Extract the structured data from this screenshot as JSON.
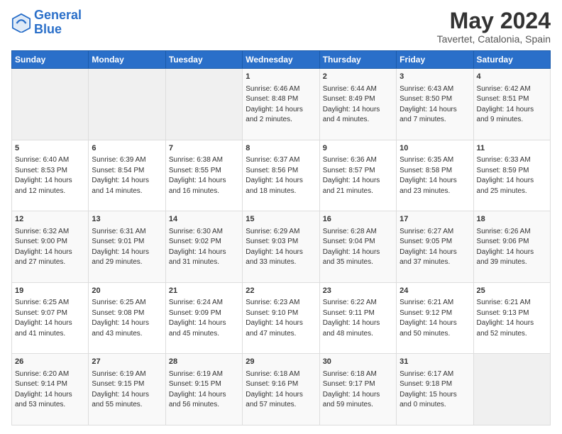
{
  "header": {
    "logo_line1": "General",
    "logo_line2": "Blue",
    "main_title": "May 2024",
    "subtitle": "Tavertet, Catalonia, Spain"
  },
  "calendar": {
    "columns": [
      "Sunday",
      "Monday",
      "Tuesday",
      "Wednesday",
      "Thursday",
      "Friday",
      "Saturday"
    ],
    "weeks": [
      [
        {
          "day": "",
          "info": ""
        },
        {
          "day": "",
          "info": ""
        },
        {
          "day": "",
          "info": ""
        },
        {
          "day": "1",
          "info": "Sunrise: 6:46 AM\nSunset: 8:48 PM\nDaylight: 14 hours\nand 2 minutes."
        },
        {
          "day": "2",
          "info": "Sunrise: 6:44 AM\nSunset: 8:49 PM\nDaylight: 14 hours\nand 4 minutes."
        },
        {
          "day": "3",
          "info": "Sunrise: 6:43 AM\nSunset: 8:50 PM\nDaylight: 14 hours\nand 7 minutes."
        },
        {
          "day": "4",
          "info": "Sunrise: 6:42 AM\nSunset: 8:51 PM\nDaylight: 14 hours\nand 9 minutes."
        }
      ],
      [
        {
          "day": "5",
          "info": "Sunrise: 6:40 AM\nSunset: 8:53 PM\nDaylight: 14 hours\nand 12 minutes."
        },
        {
          "day": "6",
          "info": "Sunrise: 6:39 AM\nSunset: 8:54 PM\nDaylight: 14 hours\nand 14 minutes."
        },
        {
          "day": "7",
          "info": "Sunrise: 6:38 AM\nSunset: 8:55 PM\nDaylight: 14 hours\nand 16 minutes."
        },
        {
          "day": "8",
          "info": "Sunrise: 6:37 AM\nSunset: 8:56 PM\nDaylight: 14 hours\nand 18 minutes."
        },
        {
          "day": "9",
          "info": "Sunrise: 6:36 AM\nSunset: 8:57 PM\nDaylight: 14 hours\nand 21 minutes."
        },
        {
          "day": "10",
          "info": "Sunrise: 6:35 AM\nSunset: 8:58 PM\nDaylight: 14 hours\nand 23 minutes."
        },
        {
          "day": "11",
          "info": "Sunrise: 6:33 AM\nSunset: 8:59 PM\nDaylight: 14 hours\nand 25 minutes."
        }
      ],
      [
        {
          "day": "12",
          "info": "Sunrise: 6:32 AM\nSunset: 9:00 PM\nDaylight: 14 hours\nand 27 minutes."
        },
        {
          "day": "13",
          "info": "Sunrise: 6:31 AM\nSunset: 9:01 PM\nDaylight: 14 hours\nand 29 minutes."
        },
        {
          "day": "14",
          "info": "Sunrise: 6:30 AM\nSunset: 9:02 PM\nDaylight: 14 hours\nand 31 minutes."
        },
        {
          "day": "15",
          "info": "Sunrise: 6:29 AM\nSunset: 9:03 PM\nDaylight: 14 hours\nand 33 minutes."
        },
        {
          "day": "16",
          "info": "Sunrise: 6:28 AM\nSunset: 9:04 PM\nDaylight: 14 hours\nand 35 minutes."
        },
        {
          "day": "17",
          "info": "Sunrise: 6:27 AM\nSunset: 9:05 PM\nDaylight: 14 hours\nand 37 minutes."
        },
        {
          "day": "18",
          "info": "Sunrise: 6:26 AM\nSunset: 9:06 PM\nDaylight: 14 hours\nand 39 minutes."
        }
      ],
      [
        {
          "day": "19",
          "info": "Sunrise: 6:25 AM\nSunset: 9:07 PM\nDaylight: 14 hours\nand 41 minutes."
        },
        {
          "day": "20",
          "info": "Sunrise: 6:25 AM\nSunset: 9:08 PM\nDaylight: 14 hours\nand 43 minutes."
        },
        {
          "day": "21",
          "info": "Sunrise: 6:24 AM\nSunset: 9:09 PM\nDaylight: 14 hours\nand 45 minutes."
        },
        {
          "day": "22",
          "info": "Sunrise: 6:23 AM\nSunset: 9:10 PM\nDaylight: 14 hours\nand 47 minutes."
        },
        {
          "day": "23",
          "info": "Sunrise: 6:22 AM\nSunset: 9:11 PM\nDaylight: 14 hours\nand 48 minutes."
        },
        {
          "day": "24",
          "info": "Sunrise: 6:21 AM\nSunset: 9:12 PM\nDaylight: 14 hours\nand 50 minutes."
        },
        {
          "day": "25",
          "info": "Sunrise: 6:21 AM\nSunset: 9:13 PM\nDaylight: 14 hours\nand 52 minutes."
        }
      ],
      [
        {
          "day": "26",
          "info": "Sunrise: 6:20 AM\nSunset: 9:14 PM\nDaylight: 14 hours\nand 53 minutes."
        },
        {
          "day": "27",
          "info": "Sunrise: 6:19 AM\nSunset: 9:15 PM\nDaylight: 14 hours\nand 55 minutes."
        },
        {
          "day": "28",
          "info": "Sunrise: 6:19 AM\nSunset: 9:15 PM\nDaylight: 14 hours\nand 56 minutes."
        },
        {
          "day": "29",
          "info": "Sunrise: 6:18 AM\nSunset: 9:16 PM\nDaylight: 14 hours\nand 57 minutes."
        },
        {
          "day": "30",
          "info": "Sunrise: 6:18 AM\nSunset: 9:17 PM\nDaylight: 14 hours\nand 59 minutes."
        },
        {
          "day": "31",
          "info": "Sunrise: 6:17 AM\nSunset: 9:18 PM\nDaylight: 15 hours\nand 0 minutes."
        },
        {
          "day": "",
          "info": ""
        }
      ]
    ]
  }
}
